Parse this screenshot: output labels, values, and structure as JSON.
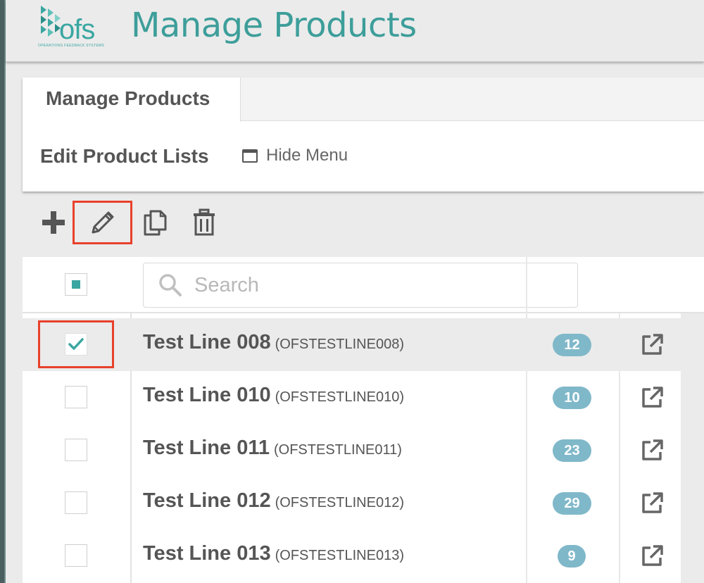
{
  "header": {
    "logo_text": "ofs",
    "logo_subtitle": "OPERATIONS FEEDBACK SYSTEMS",
    "title": "Manage Products"
  },
  "panel": {
    "tab_label": "Manage Products",
    "section_title": "Edit Product Lists",
    "hide_menu_label": "Hide Menu"
  },
  "toolbar": {
    "add_icon": "plus-icon",
    "edit_icon": "pencil-icon",
    "copy_icon": "copy-icon",
    "delete_icon": "trash-icon"
  },
  "search": {
    "placeholder": "Search"
  },
  "rows": [
    {
      "name": "Test Line 008",
      "code": "(OFSTESTLINE008)",
      "count": "12",
      "selected": true
    },
    {
      "name": "Test Line 010",
      "code": "(OFSTESTLINE010)",
      "count": "10",
      "selected": false
    },
    {
      "name": "Test Line 011",
      "code": "(OFSTESTLINE011)",
      "count": "23",
      "selected": false
    },
    {
      "name": "Test Line 012",
      "code": "(OFSTESTLINE012)",
      "count": "29",
      "selected": false
    },
    {
      "name": "Test Line 013",
      "code": "(OFSTESTLINE013)",
      "count": "9",
      "selected": false
    }
  ],
  "colors": {
    "brand_teal": "#3aa6a1",
    "badge": "#7fb8c9",
    "highlight": "#e8412c"
  }
}
